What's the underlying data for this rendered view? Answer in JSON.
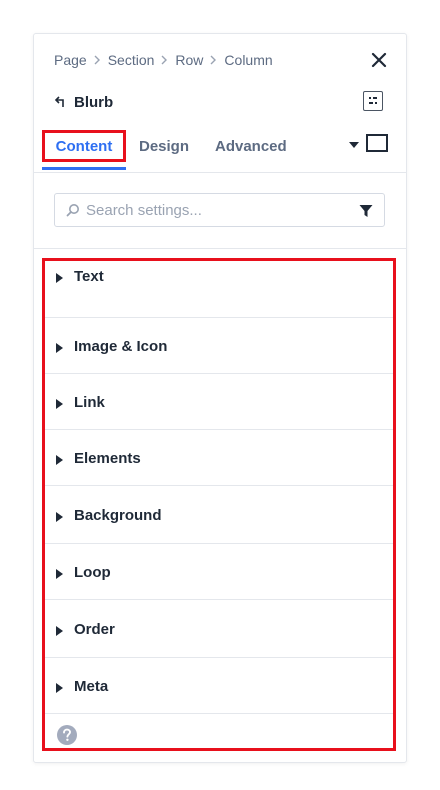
{
  "breadcrumb": [
    "Page",
    "Section",
    "Row",
    "Column"
  ],
  "header": {
    "module_name": "Blurb"
  },
  "tabs": [
    {
      "label": "Content",
      "active": true
    },
    {
      "label": "Design",
      "active": false
    },
    {
      "label": "Advanced",
      "active": false
    }
  ],
  "search": {
    "placeholder": "Search settings...",
    "value": ""
  },
  "groups": [
    {
      "label": "Text"
    },
    {
      "label": "Image & Icon"
    },
    {
      "label": "Link"
    },
    {
      "label": "Elements"
    },
    {
      "label": "Background"
    },
    {
      "label": "Loop"
    },
    {
      "label": "Order"
    },
    {
      "label": "Meta"
    }
  ],
  "colors": {
    "accent": "#2e6ff2",
    "highlight": "#e8101c",
    "text": "#1f2937",
    "muted": "#5d6b82"
  }
}
